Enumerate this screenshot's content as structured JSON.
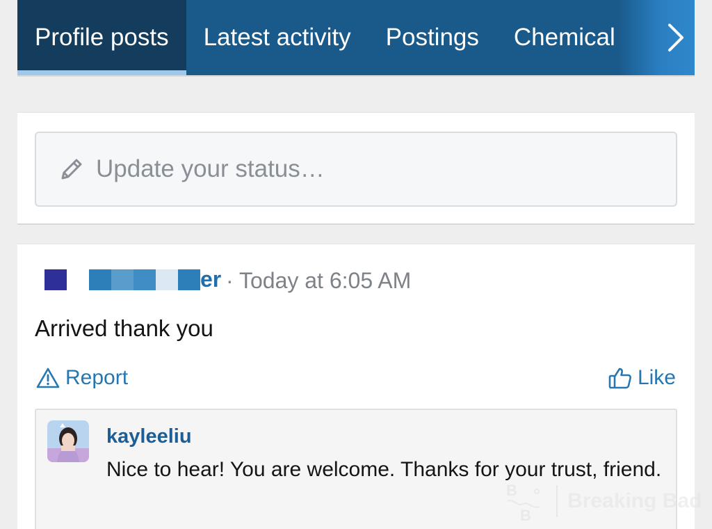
{
  "tabs": [
    {
      "label": "Profile posts",
      "active": true
    },
    {
      "label": "Latest activity",
      "active": false
    },
    {
      "label": "Postings",
      "active": false
    },
    {
      "label": "Chemical",
      "active": false
    }
  ],
  "status": {
    "placeholder": "Update your status…"
  },
  "post": {
    "author_visible_suffix": "er",
    "time": "· Today at 6:05 AM",
    "text": "Arrived thank you",
    "report_label": "Report",
    "like_label": "Like"
  },
  "comment": {
    "author": "kayleeliu",
    "text": "Nice to hear! You are welcome. Thanks for your trust, friend."
  },
  "watermark": {
    "text": "Breaking Bad"
  },
  "colors": {
    "tab_bg": "#195a8b",
    "tab_active_bg": "#143c5d",
    "link_blue": "#2577b1",
    "username_blue": "#1d5e96"
  },
  "icons": [
    "chevron-right-icon",
    "pencil-icon",
    "warning-icon",
    "thumbs-up-icon"
  ]
}
